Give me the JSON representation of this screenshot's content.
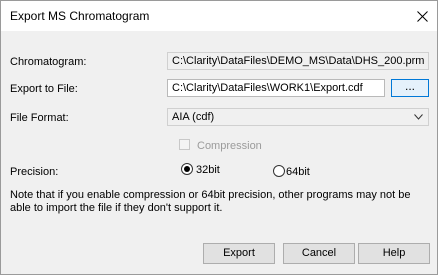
{
  "window": {
    "title": "Export MS Chromatogram"
  },
  "chromatogram": {
    "label": "Chromatogram:",
    "value": "C:\\Clarity\\DataFiles\\DEMO_MS\\Data\\DHS_200.prm"
  },
  "export_to_file": {
    "label": "Export to File:",
    "value": "C:\\Clarity\\DataFiles\\WORK1\\Export.cdf",
    "browse_label": "..."
  },
  "file_format": {
    "label": "File Format:",
    "selected": "AIA (cdf)"
  },
  "compression": {
    "label": "Compression",
    "checked": false,
    "enabled": false
  },
  "precision": {
    "label": "Precision:",
    "options": [
      {
        "label": "32bit",
        "selected": true
      },
      {
        "label": "64bit",
        "selected": false
      }
    ]
  },
  "note": "Note that if you enable compression or 64bit precision, other programs may not be able to import the file if they don't support it.",
  "buttons": {
    "export": "Export",
    "cancel": "Cancel",
    "help": "Help"
  }
}
